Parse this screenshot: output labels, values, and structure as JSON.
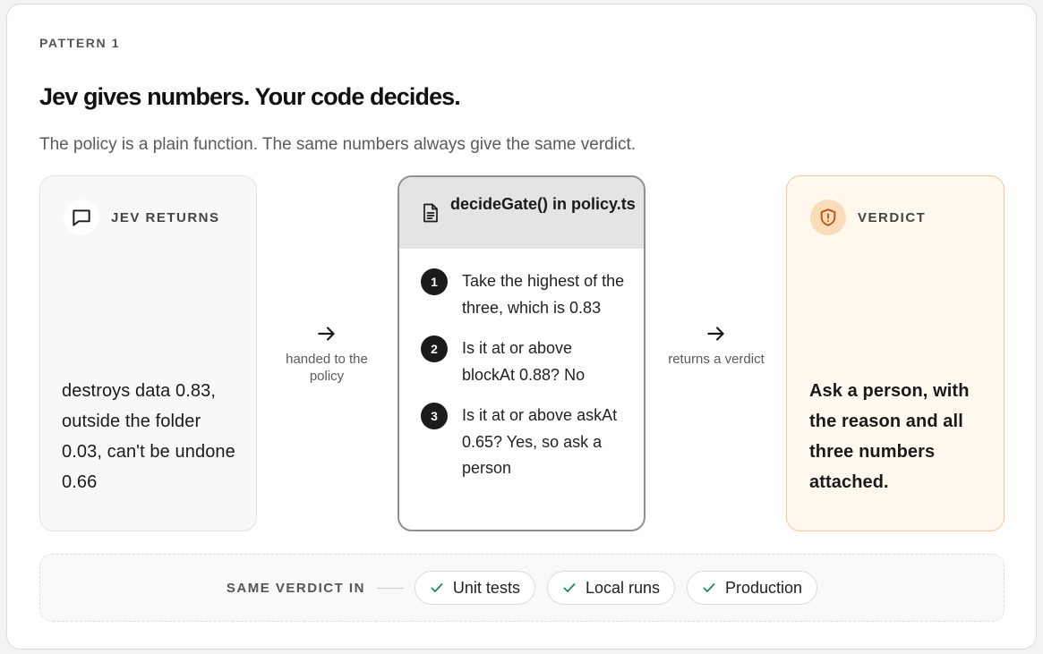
{
  "eyebrow": "PATTERN 1",
  "headline": "Jev gives numbers. Your code decides.",
  "subline": "The policy is a plain function. The same numbers always give the same verdict.",
  "input_box": {
    "label": "JEV RETURNS",
    "icon": "chat-bubble-icon",
    "body": "destroys data 0.83, outside the folder 0.03, can't be undone 0.66"
  },
  "connector_1": {
    "label": "handed to the policy"
  },
  "policy_box": {
    "title": "decideGate() in policy.ts",
    "icon": "document-icon",
    "steps": [
      {
        "num": "1",
        "text": "Take the highest of the three, which is 0.83"
      },
      {
        "num": "2",
        "text": "Is it at or above blockAt 0.88? No"
      },
      {
        "num": "3",
        "text": "Is it at or above askAt 0.65? Yes, so ask a person"
      }
    ]
  },
  "connector_2": {
    "label": "returns a verdict"
  },
  "verdict_box": {
    "label": "VERDICT",
    "icon": "shield-alert-icon",
    "body": "Ask a person, with the reason and all three numbers attached."
  },
  "bottom": {
    "label": "SAME VERDICT IN",
    "chips": [
      "Unit tests",
      "Local runs",
      "Production"
    ]
  },
  "colors": {
    "verdict_bg": "#fff8ee",
    "verdict_border": "#f1c998",
    "verdict_icon": "#b4530c",
    "check": "#1f8a55"
  }
}
